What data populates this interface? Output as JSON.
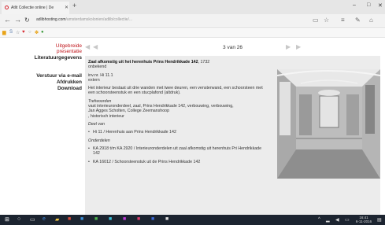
{
  "browser": {
    "tab_title": "Atlit Collectie online | De",
    "url_host": "adlibhosting.com",
    "url_path": "/amsterdamskolonien/adlib/collectie/..."
  },
  "leftnav": {
    "selected_line1": "Uitgebreide",
    "selected_line2": "presentatie",
    "literature": "Literatuurgegevens",
    "email": "Verstuur via e-mail",
    "print": "Afdrukken",
    "download": "Download"
  },
  "pager": {
    "count": "3 van 26"
  },
  "record": {
    "title": "Zaal afkomstig uit het herenhuis Prins Hendrikkade 142",
    "year": ", 1732",
    "maker": "onbekend",
    "inventory": "inv.nr. Hi 11.1",
    "location": "extern",
    "description": "Het interieur bestaat uit drie wanden met twee deuren, een vensterwand, een schoorsteen met een schoorsteenstuk en een stucplafond (altdruk).",
    "keywords_heading": "Trefwoorden",
    "keywords_line1": "vast interieuronderdeel, zaal, Prins Hendrikkade 142, verbouwing, verbouwing,",
    "keywords_line2": "Jan Agges Scholten, College Zeemanshoop",
    "keywords_line3": ", historisch interieur",
    "part_of_heading": "Deel van",
    "part_of_item": "Hi 11 / Herenhuis aan Prins Hendrikkade 142",
    "components_heading": "Onderdelen",
    "component1": "KA 2918 t/m KA 2920 / Interieuronderdelen uit zaal afkomstig uit herenhuis Pri Hendrikkade 142",
    "component2": "KA 16012 / Schoorsteenstuk uit de Prins Hendrikkade 142"
  },
  "taskbar": {
    "time": "16:41",
    "date": "6-11-2016"
  },
  "colors": {
    "accent_red": "#c0161c",
    "panel_bg": "#ececec",
    "taskbar_bg": "#1c2430"
  }
}
